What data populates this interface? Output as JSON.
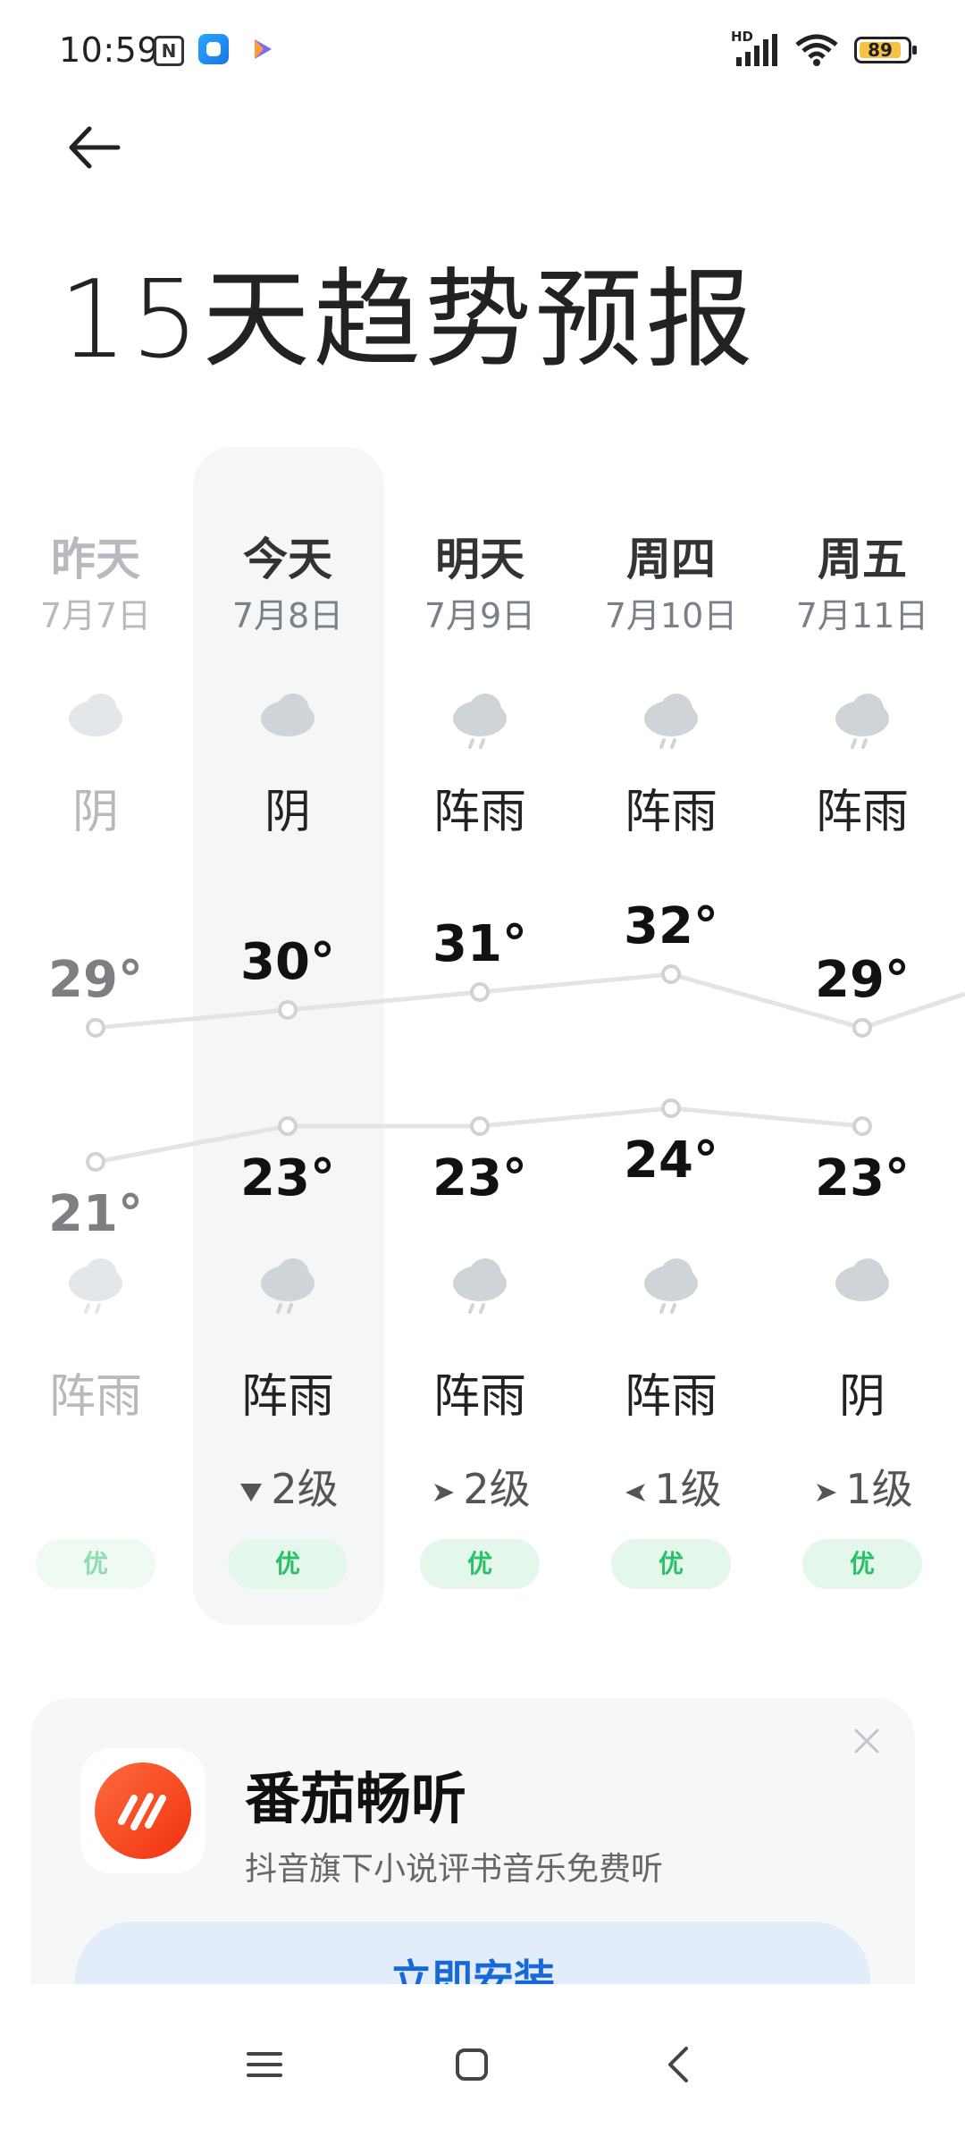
{
  "status_bar": {
    "time": "10:59",
    "battery": "89",
    "network": "HD",
    "icons": [
      "nfc-icon",
      "app-icon",
      "play-icon",
      "signal-icon",
      "wifi-icon",
      "battery-icon"
    ]
  },
  "header": {
    "title": "15天趋势预报",
    "back_icon": "arrow-left-icon"
  },
  "forecast": {
    "days": [
      {
        "name": "昨天",
        "date": "7月7日",
        "day_weather": "阴",
        "day_icon": "cloud",
        "high": "29°",
        "low": "21°",
        "night_weather": "阵雨",
        "night_icon": "rain",
        "wind": "",
        "aqi": "优",
        "past": true
      },
      {
        "name": "今天",
        "date": "7月8日",
        "day_weather": "阴",
        "day_icon": "cloud",
        "high": "30°",
        "low": "23°",
        "night_weather": "阵雨",
        "night_icon": "rain",
        "wind": "2级",
        "wind_dir_icon": "arrow-down-icon",
        "aqi": "优",
        "today": true
      },
      {
        "name": "明天",
        "date": "7月9日",
        "day_weather": "阵雨",
        "day_icon": "rain",
        "high": "31°",
        "low": "23°",
        "night_weather": "阵雨",
        "night_icon": "rain",
        "wind": "2级",
        "wind_dir_icon": "arrow-right-icon",
        "aqi": "优"
      },
      {
        "name": "周四",
        "date": "7月10日",
        "day_weather": "阵雨",
        "day_icon": "rain",
        "high": "32°",
        "low": "24°",
        "night_weather": "阵雨",
        "night_icon": "rain",
        "wind": "1级",
        "wind_dir_icon": "arrow-left-icon",
        "aqi": "优"
      },
      {
        "name": "周五",
        "date": "7月11日",
        "day_weather": "阵雨",
        "day_icon": "rain",
        "high": "29°",
        "low": "23°",
        "night_weather": "阴",
        "night_icon": "cloud",
        "wind": "1级",
        "wind_dir_icon": "arrow-right-icon",
        "aqi": "优"
      }
    ]
  },
  "chart_data": {
    "type": "line",
    "categories": [
      "7月7日",
      "7月8日",
      "7月9日",
      "7月10日",
      "7月11日"
    ],
    "series": [
      {
        "values": [
          29,
          30,
          31,
          32,
          29
        ]
      },
      {
        "values": [
          21,
          23,
          23,
          24,
          23
        ]
      }
    ]
  },
  "ad": {
    "title": "番茄畅听",
    "subtitle": "抖音旗下小说评书音乐免费听",
    "install_label": "立即安装",
    "close_icon": "close-icon",
    "logo_icon": "app-logo-icon"
  },
  "nav_bar": {
    "icons": [
      "menu-icon",
      "home-icon",
      "back-icon"
    ]
  },
  "colors": {
    "accent_text": "#1769d8",
    "aqi_good": "#2bbf6a",
    "today_bg": "#f5f6f7"
  }
}
